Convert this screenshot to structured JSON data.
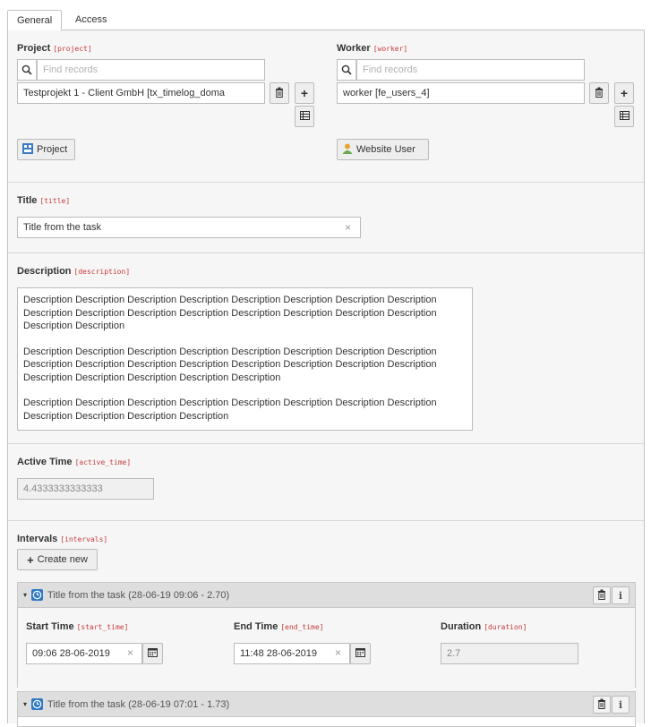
{
  "tabs": [
    {
      "label": "General"
    },
    {
      "label": "Access"
    }
  ],
  "project": {
    "label": "Project",
    "field": "[project]",
    "search_placeholder": "Find records",
    "value": "Testprojekt 1 - Client GmbH [tx_timelog_doma",
    "button_label": "Project"
  },
  "worker": {
    "label": "Worker",
    "field": "[worker]",
    "search_placeholder": "Find records",
    "value": "worker [fe_users_4]",
    "button_label": "Website User"
  },
  "title": {
    "label": "Title",
    "field": "[title]",
    "value": "Title from the task"
  },
  "description": {
    "label": "Description",
    "field": "[description]",
    "paragraphs": [
      "Description Description Description Description Description Description Description Description Description Description Description Description Description Description Description Description Description Description",
      "Description Description Description Description Description Description Description Description Description Description Description Description Description Description Description Description Description Description Description Description Description",
      "Description Description Description Description Description Description Description Description Description Description Description Description"
    ]
  },
  "active_time": {
    "label": "Active Time",
    "field": "[active_time]",
    "value": "4.4333333333333"
  },
  "intervals": {
    "label": "Intervals",
    "field": "[intervals]",
    "create_label": "Create new",
    "items": [
      {
        "title": "Title from the task (28-06-19 09:06 - 2.70)",
        "start_label": "Start Time",
        "start_field": "[start_time]",
        "start_value": "09:06 28-06-2019",
        "end_label": "End Time",
        "end_field": "[end_time]",
        "end_value": "11:48 28-06-2019",
        "duration_label": "Duration",
        "duration_field": "[duration]",
        "duration_value": "2.7"
      },
      {
        "title": "Title from the task (28-06-19 07:01 - 1.73)"
      }
    ]
  }
}
